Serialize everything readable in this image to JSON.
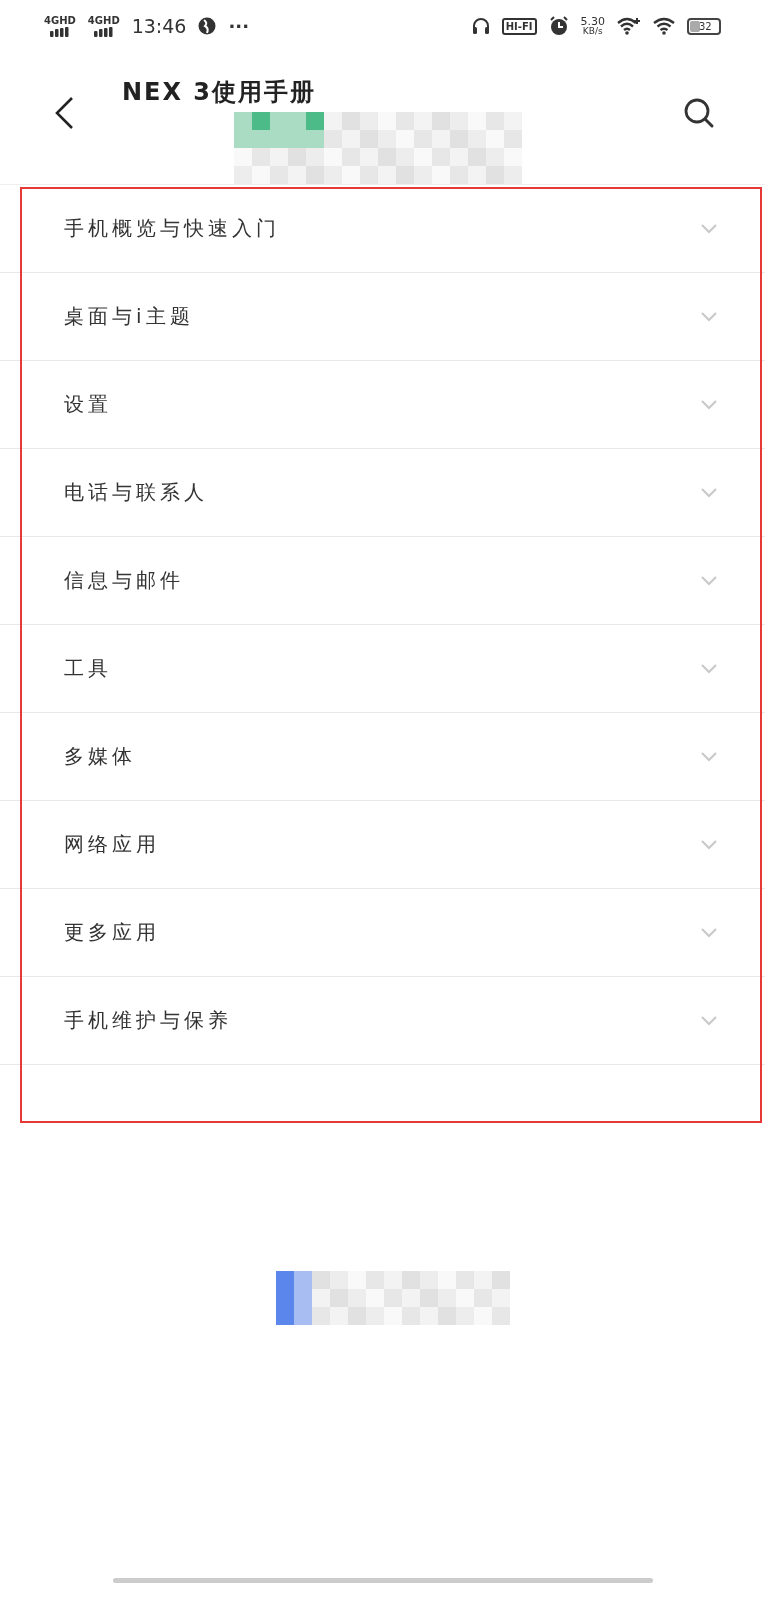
{
  "status_bar": {
    "networks": [
      "4GHD",
      "4GHD"
    ],
    "time": "13:46",
    "more": "···",
    "hifi": "HI-FI",
    "speed": "5.30",
    "speed_unit": "KB/s",
    "battery": {
      "text": "32",
      "level": 0.32
    }
  },
  "header": {
    "title": "NEX 3使用手册"
  },
  "sections": [
    {
      "label": "手机概览与快速入门",
      "expanded": false
    },
    {
      "label": "桌面与i主题",
      "expanded": false
    },
    {
      "label": "设置",
      "expanded": false
    },
    {
      "label": "电话与联系人",
      "expanded": false
    },
    {
      "label": "信息与邮件",
      "expanded": false
    },
    {
      "label": "工具",
      "expanded": false
    },
    {
      "label": "多媒体",
      "expanded": false
    },
    {
      "label": "网络应用",
      "expanded": false
    },
    {
      "label": "更多应用",
      "expanded": false
    },
    {
      "label": "手机维护与保养",
      "expanded": false
    }
  ]
}
